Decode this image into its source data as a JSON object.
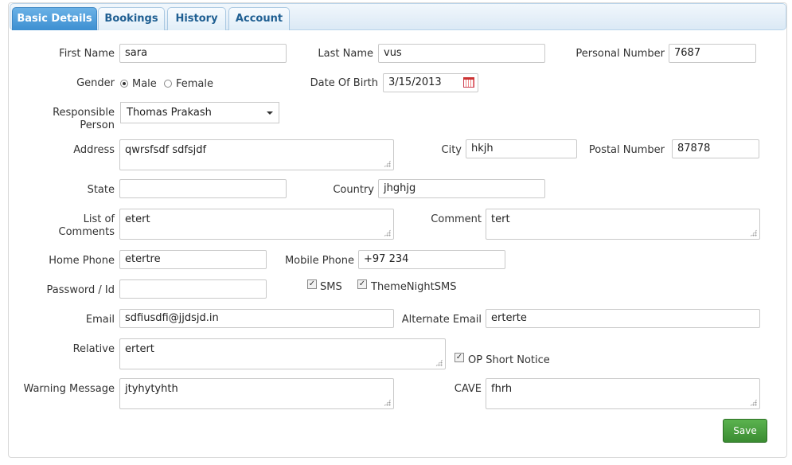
{
  "tabs": [
    "Basic Details",
    "Bookings",
    "History",
    "Account"
  ],
  "labels": {
    "first_name": "First Name",
    "last_name": "Last Name",
    "personal_number": "Personal Number",
    "gender": "Gender",
    "date_of_birth": "Date Of Birth",
    "responsible_person_1": "Responsible",
    "responsible_person_2": "Person",
    "address": "Address",
    "city": "City",
    "postal_number": "Postal Number",
    "state": "State",
    "country": "Country",
    "list_of_comments_1": "List of",
    "list_of_comments_2": "Comments",
    "comment": "Comment",
    "home_phone": "Home Phone",
    "mobile_phone": "Mobile Phone",
    "password_id": "Password / Id",
    "email": "Email",
    "alternate_email": "Alternate Email",
    "relative": "Relative",
    "warning_message": "Warning Message",
    "cave": "CAVE"
  },
  "values": {
    "first_name": "sara",
    "last_name": "vus",
    "personal_number": "7687",
    "date_of_birth": "3/15/2013",
    "responsible_person": "Thomas Prakash",
    "address": "qwrsfsdf sdfsjdf",
    "city": "hkjh",
    "postal_number": "87878",
    "state": "",
    "country": "jhghjg",
    "list_of_comments": "etert",
    "comment": "tert",
    "home_phone": "etertre",
    "mobile_phone": "+97 234",
    "password_id": "",
    "email": "sdfiusdfi@jjdsjd.in",
    "alternate_email": "erterte",
    "relative": "ertert",
    "warning_message": "jtyhytyhth",
    "cave": "fhrh"
  },
  "gender": {
    "male": "Male",
    "female": "Female",
    "selected": "Male"
  },
  "checkboxes": {
    "sms": "SMS",
    "theme_night_sms": "ThemeNightSMS",
    "op_short_notice": "OP Short Notice"
  },
  "save_label": "Save"
}
